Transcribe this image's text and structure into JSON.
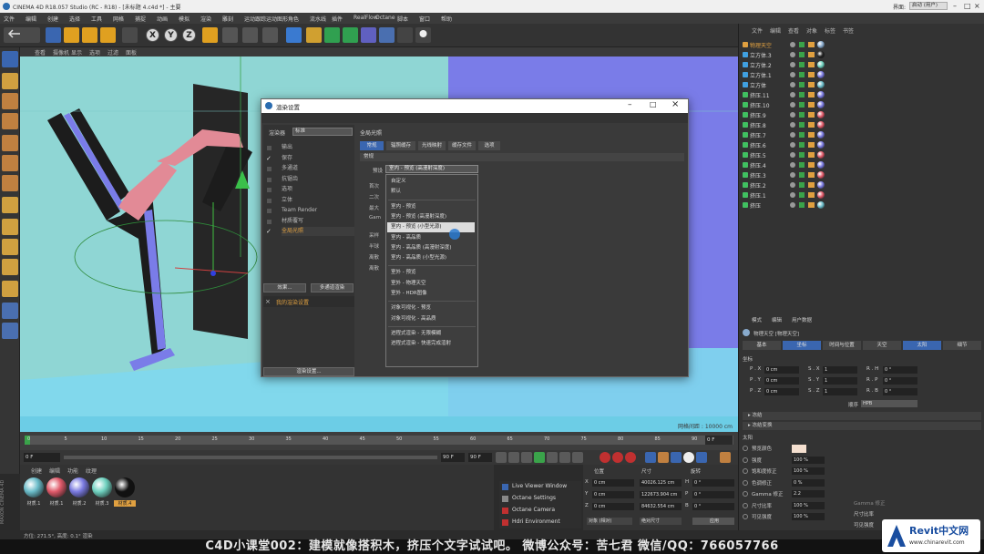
{
  "window": {
    "title": "CINEMA 4D R18.057 Studio (RC - R18) - [未标题 4.c4d *] - 主要",
    "layout_label": "界面:",
    "layout_value": "启动 (用户)"
  },
  "menubar": [
    "文件",
    "编辑",
    "创建",
    "选择",
    "工具",
    "网格",
    "捕捉",
    "动画",
    "模拟",
    "渲染",
    "雕刻",
    "运动跟踪",
    "运动图形",
    "角色",
    "流水线",
    "插件",
    "RealFlow",
    "Octane",
    "脚本",
    "窗口",
    "帮助"
  ],
  "viewport": {
    "menu": [
      "查看",
      "摄像机",
      "显示",
      "选项",
      "过滤",
      "面板"
    ],
    "grid_label": "网格间距 : 10000 cm"
  },
  "timeline": {
    "ticks": [
      "0",
      "5",
      "10",
      "15",
      "20",
      "25",
      "30",
      "35",
      "40",
      "45",
      "50",
      "55",
      "60",
      "65",
      "70",
      "75",
      "80",
      "85",
      "90"
    ],
    "frame_field": "0 F",
    "end_field": "90 F",
    "end_field2": "90 F",
    "right_marker": "0 F"
  },
  "materials": {
    "menu": [
      "创建",
      "编辑",
      "功能",
      "纹理"
    ],
    "items": [
      {
        "label": "材质.1",
        "color": "#6bbcc9"
      },
      {
        "label": "材质.1",
        "color": "#e05a6a"
      },
      {
        "label": "材质.2",
        "color": "#7a7ae0"
      },
      {
        "label": "材质.3",
        "color": "#6fd1bf"
      },
      {
        "label": "材质.4",
        "color": "#111111"
      }
    ],
    "selected_label": "材质.4"
  },
  "octane_menu": [
    "Live Viewer Window",
    "Octane Settings",
    "Octane Camera",
    "Hdri Environment"
  ],
  "coords": {
    "headers": [
      "位置",
      "尺寸",
      "旋转"
    ],
    "rows": [
      {
        "axis": "X",
        "pos": "0 cm",
        "size": "40026.125 cm",
        "rot_axis": "H",
        "rot": "0 °"
      },
      {
        "axis": "Y",
        "pos": "0 cm",
        "size": "122673.904 cm",
        "rot_axis": "P",
        "rot": "0 °"
      },
      {
        "axis": "Z",
        "pos": "0 cm",
        "size": "84632.554 cm",
        "rot_axis": "B",
        "rot": "0 °"
      }
    ],
    "mode1": "对象 (相对)",
    "mode2": "绝对尺寸",
    "apply": "应用"
  },
  "objects": {
    "menu": [
      "文件",
      "编辑",
      "查看",
      "对象",
      "标签",
      "书签"
    ],
    "items": [
      {
        "name": "物理天空",
        "color": "#e0a040",
        "tag": "#88aacc",
        "selected": true
      },
      {
        "name": "立方体.3",
        "color": "#40a0e0",
        "tag": "#222222",
        "selected": false
      },
      {
        "name": "立方体.2",
        "color": "#40a0e0",
        "tag": "#6fd1bf",
        "selected": false
      },
      {
        "name": "立方体.1",
        "color": "#40a0e0",
        "tag": "#7a7ae0",
        "selected": false
      },
      {
        "name": "立方体",
        "color": "#40a0e0",
        "tag": "#6bbcc9",
        "selected": false
      },
      {
        "name": "挤压.11",
        "color": "#40c060",
        "tag": "#7a7ae0",
        "selected": false
      },
      {
        "name": "挤压.10",
        "color": "#40c060",
        "tag": "#7a7ae0",
        "selected": false
      },
      {
        "name": "挤压.9",
        "color": "#40c060",
        "tag": "#e05a6a",
        "selected": false
      },
      {
        "name": "挤压.8",
        "color": "#40c060",
        "tag": "#e05a6a",
        "selected": false
      },
      {
        "name": "挤压.7",
        "color": "#40c060",
        "tag": "#7a7ae0",
        "selected": false
      },
      {
        "name": "挤压.6",
        "color": "#40c060",
        "tag": "#7a7ae0",
        "selected": false
      },
      {
        "name": "挤压.5",
        "color": "#40c060",
        "tag": "#e05a6a",
        "selected": false
      },
      {
        "name": "挤压.4",
        "color": "#40c060",
        "tag": "#7a7ae0",
        "selected": false
      },
      {
        "name": "挤压.3",
        "color": "#40c060",
        "tag": "#e05a6a",
        "selected": false
      },
      {
        "name": "挤压.2",
        "color": "#40c060",
        "tag": "#7a7ae0",
        "selected": false
      },
      {
        "name": "挤压.1",
        "color": "#40c060",
        "tag": "#e05a6a",
        "selected": false
      },
      {
        "name": "挤压",
        "color": "#40c060",
        "tag": "#6bbcc9",
        "selected": false
      }
    ]
  },
  "attributes": {
    "menu": [
      "模式",
      "编辑",
      "用户数据"
    ],
    "object_title": "物理天空 [物理天空]",
    "tabs": [
      "基本",
      "坐标",
      "时间与位置",
      "天空",
      "太阳",
      "细节"
    ],
    "active_tab": "坐标",
    "section_coords": "坐标",
    "coords": [
      {
        "l1": "P . X",
        "v1": "0 cm",
        "l2": "S . X",
        "v2": "1",
        "l3": "R . H",
        "v3": "0 °"
      },
      {
        "l1": "P . Y",
        "v1": "0 cm",
        "l2": "S . Y",
        "v2": "1",
        "l3": "R . P",
        "v3": "0 °"
      },
      {
        "l1": "P . Z",
        "v1": "0 cm",
        "l2": "S . Z",
        "v2": "1",
        "l3": "R . B",
        "v3": "0 °"
      }
    ],
    "order_label": "顺序",
    "order_value": "HPB",
    "frozen": "▸ 冻结",
    "freeze_transform": "▸ 冻结变换",
    "sun_section": "太阳",
    "sun_rows": [
      {
        "label": "预览颜色",
        "value": ""
      },
      {
        "label": "强度",
        "value": "100 %"
      },
      {
        "label": "饱和度修正",
        "value": "100 %"
      },
      {
        "label": "色调修正",
        "value": "0 %"
      },
      {
        "label": "Gamma 修正",
        "value": "2.2"
      },
      {
        "label": "尺寸比率",
        "value": "100 %"
      },
      {
        "label": "可见强度",
        "value": "100 %"
      }
    ],
    "extra_gamma": "Gamma 修正",
    "extra_size": "尺寸比率",
    "extra_visible": "可见强度"
  },
  "status": "方位: 271.5°, 高度: 0.1° 渲染",
  "caption": "C4D小课堂002：建模就像搭积木，挤压个文字试试吧。  微博公众号：苦七君  微信/QQ：766057766",
  "dialog": {
    "title": "渲染设置",
    "renderer_label": "渲染器",
    "renderer_value": "标准",
    "sidebar": [
      {
        "label": "输出",
        "checked": false
      },
      {
        "label": "保存",
        "checked": true
      },
      {
        "label": "多通道",
        "checked": false
      },
      {
        "label": "抗锯齿",
        "checked": false
      },
      {
        "label": "选项",
        "checked": false
      },
      {
        "label": "立体",
        "checked": false
      },
      {
        "label": "Team Render",
        "checked": false
      },
      {
        "label": "材质覆写",
        "checked": false
      },
      {
        "label": "全局光照",
        "checked": true
      }
    ],
    "effects_button": "效果...",
    "multi_button": "多通道渲染",
    "my_setting": "我的渲染设置",
    "render_setting_button": "渲染设置...",
    "section_title": "全局光照",
    "tabs": [
      "常规",
      "辐照缓存",
      "光线映射",
      "缓存文件",
      "选项"
    ],
    "general_header": "常规",
    "preset_label": "预设",
    "preset_value": "室内 - 预览 (高漫射深度)",
    "bg_labels": [
      "首次",
      "二次",
      "最大",
      "Gam",
      "采样",
      "半球",
      "离散",
      "离散"
    ],
    "dropdown": [
      {
        "label": "自定义",
        "group": 0
      },
      {
        "label": "默认",
        "group": 0
      },
      {
        "label": "室内 - 预览",
        "group": 1
      },
      {
        "label": "室内 - 预览 (高漫射深度)",
        "group": 1
      },
      {
        "label": "室内 - 预览 (小型光源)",
        "group": 1,
        "hover": true
      },
      {
        "label": "室内 - 高品质",
        "group": 1
      },
      {
        "label": "室内 - 高品质 (高漫射深度)",
        "group": 1
      },
      {
        "label": "室内 - 高品质 (小型光源)",
        "group": 1
      },
      {
        "label": "室外 - 预览",
        "group": 2
      },
      {
        "label": "室外 - 物理天空",
        "group": 2
      },
      {
        "label": "室外 - HDR图像",
        "group": 2
      },
      {
        "label": "对象可视化 - 预览",
        "group": 3
      },
      {
        "label": "对象可视化 - 高品质",
        "group": 3
      },
      {
        "label": "进程式渲染 - 无限模糊",
        "group": 4
      },
      {
        "label": "进程式渲染 - 快速完成渲射",
        "group": 4
      }
    ]
  },
  "watermark": {
    "brand": "Revit中文网",
    "url": "www.chinarevit.com"
  }
}
